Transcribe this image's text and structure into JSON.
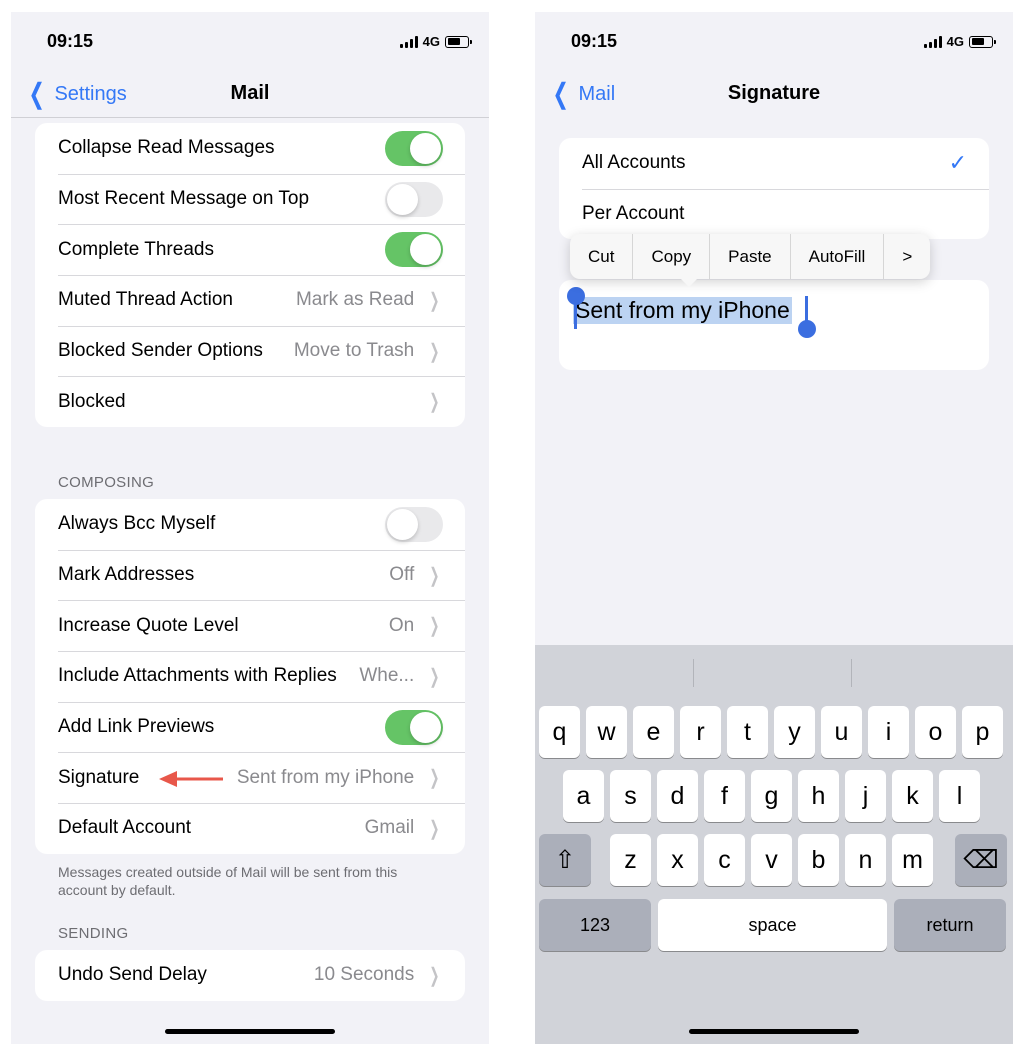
{
  "left": {
    "status": {
      "time": "09:15",
      "network": "4G"
    },
    "nav": {
      "back_label": "Settings",
      "title": "Mail"
    },
    "threading_rows": [
      {
        "label": "Collapse Read Messages",
        "type": "toggle",
        "on": true
      },
      {
        "label": "Most Recent Message on Top",
        "type": "toggle",
        "on": false
      },
      {
        "label": "Complete Threads",
        "type": "toggle",
        "on": true
      },
      {
        "label": "Muted Thread Action",
        "type": "link",
        "value": "Mark as Read"
      },
      {
        "label": "Blocked Sender Options",
        "type": "link",
        "value": "Move to Trash"
      },
      {
        "label": "Blocked",
        "type": "link",
        "value": ""
      }
    ],
    "composing_header": "COMPOSING",
    "composing_rows": [
      {
        "label": "Always Bcc Myself",
        "type": "toggle",
        "on": false
      },
      {
        "label": "Mark Addresses",
        "type": "link",
        "value": "Off"
      },
      {
        "label": "Increase Quote Level",
        "type": "link",
        "value": "On"
      },
      {
        "label": "Include Attachments with Replies",
        "type": "link",
        "value": "Whe..."
      },
      {
        "label": "Add Link Previews",
        "type": "toggle",
        "on": true
      },
      {
        "label": "Signature",
        "type": "link",
        "value": "Sent from my iPhone"
      },
      {
        "label": "Default Account",
        "type": "link",
        "value": "Gmail"
      }
    ],
    "composing_footer": "Messages created outside of Mail will be sent from this account by default.",
    "sending_header": "SENDING",
    "sending_rows": [
      {
        "label": "Undo Send Delay",
        "type": "link",
        "value": "10 Seconds"
      }
    ],
    "annotation": {
      "arrow_color": "#e8574a",
      "points_to": "Signature"
    }
  },
  "right": {
    "status": {
      "time": "09:15",
      "network": "4G"
    },
    "nav": {
      "back_label": "Mail",
      "title": "Signature"
    },
    "account_options": [
      {
        "label": "All Accounts",
        "checked": true
      },
      {
        "label": "Per Account",
        "checked": false
      }
    ],
    "edit_menu": [
      "Cut",
      "Copy",
      "Paste",
      "AutoFill",
      ">"
    ],
    "signature_text": "Sent from my iPhone",
    "keyboard": {
      "row1": [
        "q",
        "w",
        "e",
        "r",
        "t",
        "y",
        "u",
        "i",
        "o",
        "p"
      ],
      "row2": [
        "a",
        "s",
        "d",
        "f",
        "g",
        "h",
        "j",
        "k",
        "l"
      ],
      "row3": [
        "z",
        "x",
        "c",
        "v",
        "b",
        "n",
        "m"
      ],
      "shift": "⇧",
      "delete": "⌫",
      "numbers": "123",
      "space": "space",
      "return": "return"
    }
  },
  "colors": {
    "accent": "#3478f6",
    "toggle_on": "#65c466",
    "selection": "#bcd3f2"
  }
}
